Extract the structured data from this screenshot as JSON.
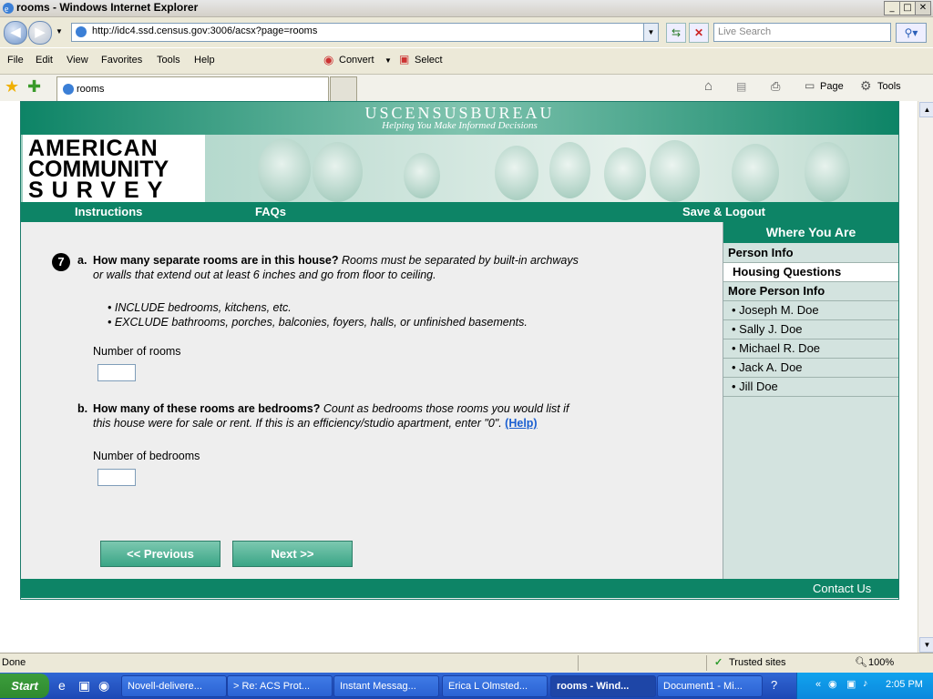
{
  "window": {
    "title": "rooms - Windows Internet Explorer",
    "min": "_",
    "max": "□",
    "close": "✕"
  },
  "toolbar": {
    "url": "http://idc4.ssd.census.gov:3006/acsx?page=rooms",
    "search_placeholder": "Live Search",
    "menus": [
      "File",
      "Edit",
      "View",
      "Favorites",
      "Tools",
      "Help"
    ],
    "convert": "Convert",
    "select": "Select",
    "tab_title": "rooms",
    "cmd_page": "Page",
    "cmd_tools": "Tools"
  },
  "census": {
    "bureau": "USCENSUSBUREAU",
    "tagline": "Helping You Make Informed Decisions",
    "logo_line1": "AMERICAN",
    "logo_line2": "COMMUNITY",
    "logo_line3": "SURVEY"
  },
  "nav": {
    "instructions": "Instructions",
    "faqs": "FAQs",
    "save_logout": "Save & Logout"
  },
  "sidebar": {
    "header": "Where You Are",
    "items": [
      {
        "label": "Person Info",
        "type": "section"
      },
      {
        "label": "Housing Questions",
        "type": "current"
      },
      {
        "label": "More Person Info",
        "type": "section"
      },
      {
        "label": "• Joseph M. Doe",
        "type": "person"
      },
      {
        "label": "• Sally J. Doe",
        "type": "person"
      },
      {
        "label": "• Michael R. Doe",
        "type": "person"
      },
      {
        "label": "• Jack A. Doe",
        "type": "person"
      },
      {
        "label": "• Jill Doe",
        "type": "person"
      }
    ]
  },
  "question": {
    "number": "7",
    "a_label": "a.",
    "a_bold": "How many separate rooms are in this house?",
    "a_italic_1": "Rooms must be separated by built-in archways",
    "a_italic_2": "or walls that extend out at least 6 inches and go from floor to ceiling.",
    "include": "• INCLUDE bedrooms, kitchens, etc.",
    "exclude": "• EXCLUDE bathrooms, porches, balconies, foyers, halls, or unfinished basements.",
    "rooms_label": "Number of rooms",
    "rooms_value": "",
    "b_label": "b.",
    "b_bold": "How many of these rooms are bedrooms?",
    "b_italic_1": "Count as bedrooms those rooms you would list if",
    "b_italic_2": "this house were for sale or rent. If this is an efficiency/studio apartment, enter \"0\".",
    "help": "(Help)",
    "bedrooms_label": "Number of bedrooms",
    "bedrooms_value": ""
  },
  "buttons": {
    "previous": "<<   Previous",
    "next": "Next   >>"
  },
  "footer": {
    "contact": "Contact Us"
  },
  "status": {
    "text": "Done",
    "zone": "Trusted sites",
    "zoom": "100%"
  },
  "taskbar": {
    "start": "Start",
    "tasks": [
      "Novell-delivere...",
      "> Re: ACS Prot...",
      "Instant Messag...",
      "Erica L Olmsted...",
      "rooms - Wind...",
      "Document1 - Mi..."
    ],
    "clock": "2:05 PM"
  },
  "colors": {
    "census_green": "#0d8466",
    "sidebar_bg": "#d3e3df"
  }
}
